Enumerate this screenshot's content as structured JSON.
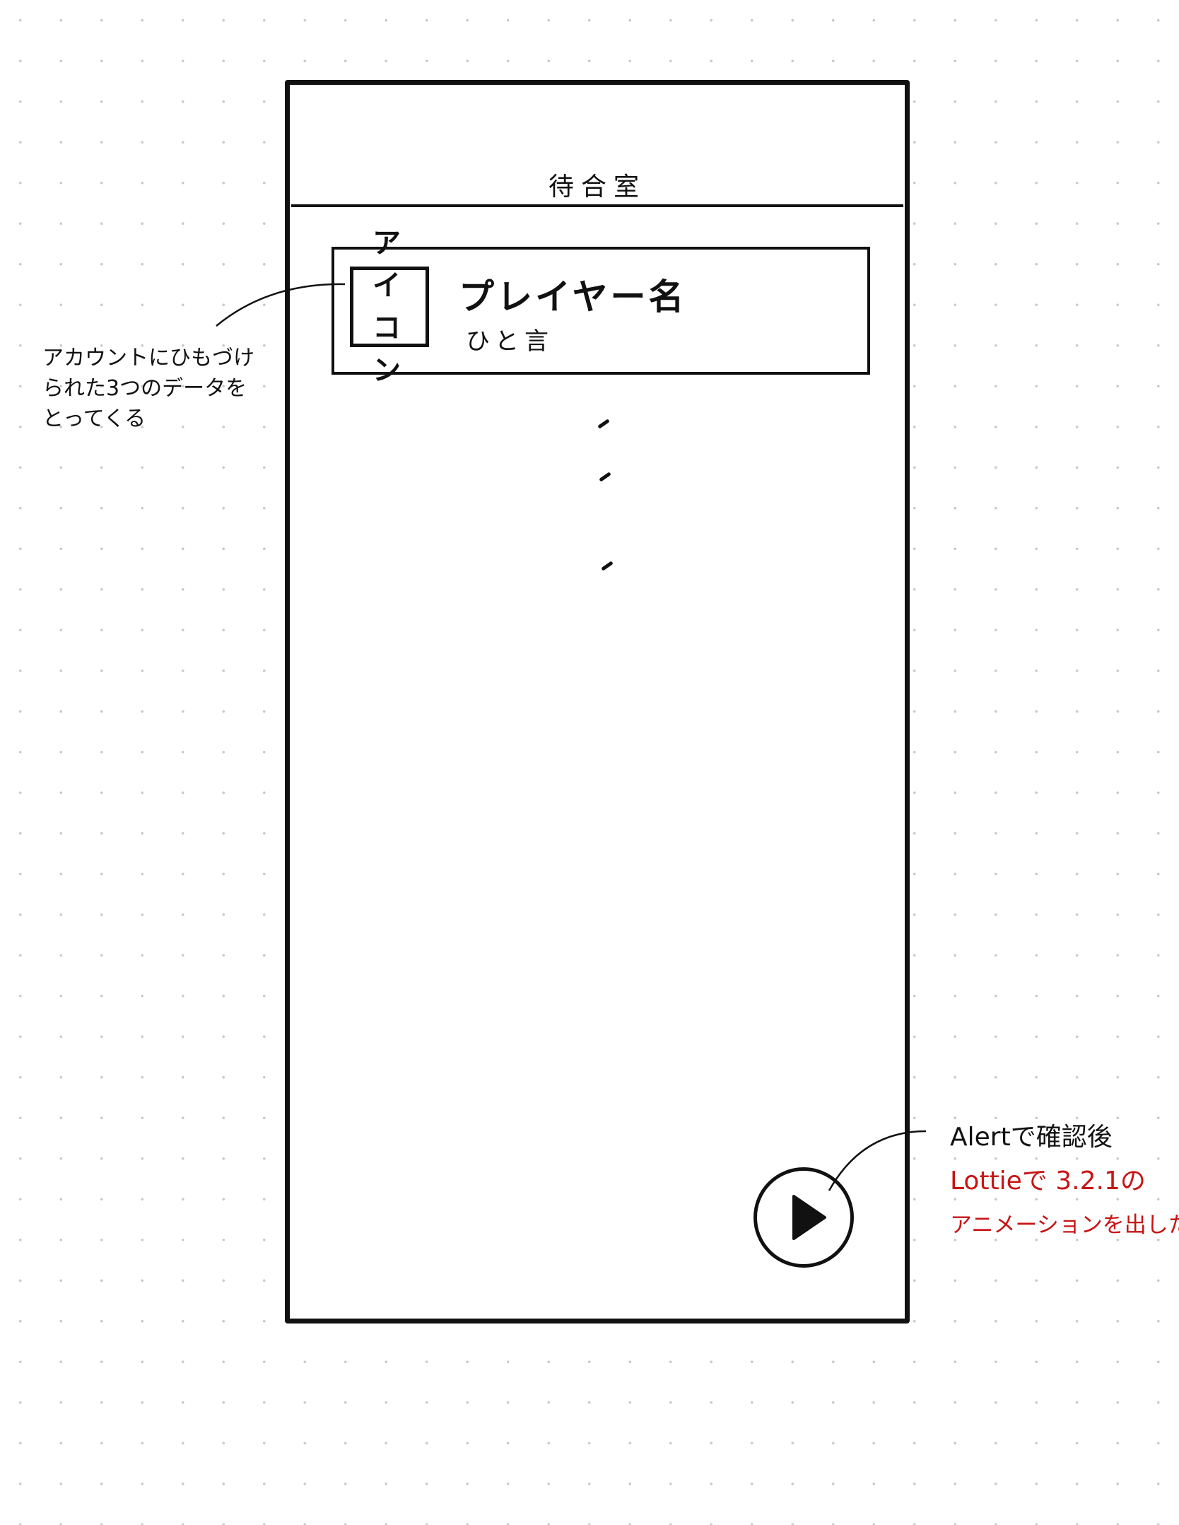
{
  "screen": {
    "title": "待合室",
    "player_card": {
      "icon_label_line1": "アイ",
      "icon_label_line2": "コン",
      "player_name": "プレイヤー名",
      "comment": "ひと言"
    },
    "list_continuation": "⋮",
    "play_button": {
      "icon": "play-icon"
    }
  },
  "annotations": {
    "card_note": [
      "アカウントにひもづけ",
      "られた3つのデータを",
      "とってくる"
    ],
    "play_note_line1": "Alertで確認後",
    "play_note_red": [
      "Lottieで 3.2.1の",
      "アニメーションを出したい"
    ],
    "red_color": "#c81414"
  }
}
